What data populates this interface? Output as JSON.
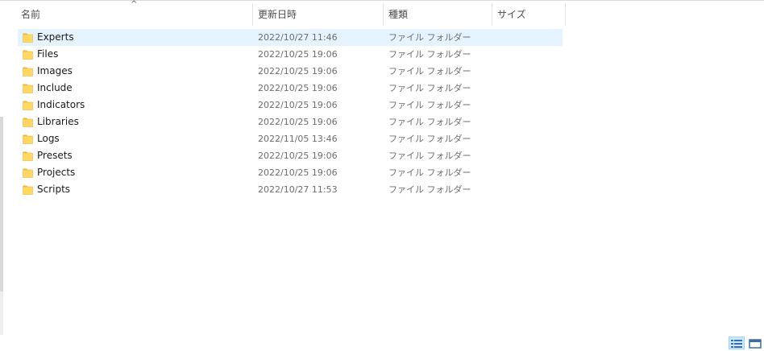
{
  "header": {
    "columns": {
      "name": "名前",
      "date": "更新日時",
      "type": "種類",
      "size": "サイズ"
    },
    "sort_indicator": "^"
  },
  "rows": [
    {
      "name": "Experts",
      "date": "2022/10/27 11:46",
      "type": "ファイル フォルダー",
      "selected": true
    },
    {
      "name": "Files",
      "date": "2022/10/25 19:06",
      "type": "ファイル フォルダー"
    },
    {
      "name": "Images",
      "date": "2022/10/25 19:06",
      "type": "ファイル フォルダー"
    },
    {
      "name": "Include",
      "date": "2022/10/25 19:06",
      "type": "ファイル フォルダー"
    },
    {
      "name": "Indicators",
      "date": "2022/10/25 19:06",
      "type": "ファイル フォルダー"
    },
    {
      "name": "Libraries",
      "date": "2022/10/25 19:06",
      "type": "ファイル フォルダー"
    },
    {
      "name": "Logs",
      "date": "2022/11/05 13:46",
      "type": "ファイル フォルダー"
    },
    {
      "name": "Presets",
      "date": "2022/10/25 19:06",
      "type": "ファイル フォルダー"
    },
    {
      "name": "Projects",
      "date": "2022/10/25 19:06",
      "type": "ファイル フォルダー"
    },
    {
      "name": "Scripts",
      "date": "2022/10/27 11:53",
      "type": "ファイル フォルダー"
    }
  ],
  "colors": {
    "selection": "#e5f3ff",
    "folder_fill": "#ffd766",
    "folder_tab": "#e8b73a",
    "view_active": "#cce8ff"
  },
  "icons": {
    "folder": "folder-icon",
    "details_view": "details-view-icon",
    "large_icons_view": "large-icons-view-icon"
  }
}
